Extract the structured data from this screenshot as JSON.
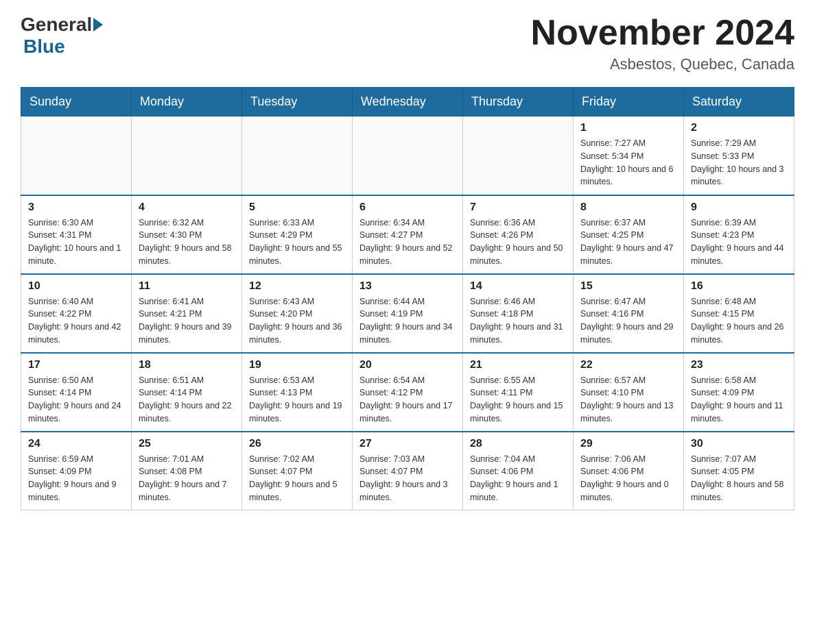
{
  "header": {
    "logo_general": "General",
    "logo_blue": "Blue",
    "month_title": "November 2024",
    "location": "Asbestos, Quebec, Canada"
  },
  "weekdays": [
    "Sunday",
    "Monday",
    "Tuesday",
    "Wednesday",
    "Thursday",
    "Friday",
    "Saturday"
  ],
  "weeks": [
    [
      {
        "day": "",
        "info": ""
      },
      {
        "day": "",
        "info": ""
      },
      {
        "day": "",
        "info": ""
      },
      {
        "day": "",
        "info": ""
      },
      {
        "day": "",
        "info": ""
      },
      {
        "day": "1",
        "info": "Sunrise: 7:27 AM\nSunset: 5:34 PM\nDaylight: 10 hours and 6 minutes."
      },
      {
        "day": "2",
        "info": "Sunrise: 7:29 AM\nSunset: 5:33 PM\nDaylight: 10 hours and 3 minutes."
      }
    ],
    [
      {
        "day": "3",
        "info": "Sunrise: 6:30 AM\nSunset: 4:31 PM\nDaylight: 10 hours and 1 minute."
      },
      {
        "day": "4",
        "info": "Sunrise: 6:32 AM\nSunset: 4:30 PM\nDaylight: 9 hours and 58 minutes."
      },
      {
        "day": "5",
        "info": "Sunrise: 6:33 AM\nSunset: 4:29 PM\nDaylight: 9 hours and 55 minutes."
      },
      {
        "day": "6",
        "info": "Sunrise: 6:34 AM\nSunset: 4:27 PM\nDaylight: 9 hours and 52 minutes."
      },
      {
        "day": "7",
        "info": "Sunrise: 6:36 AM\nSunset: 4:26 PM\nDaylight: 9 hours and 50 minutes."
      },
      {
        "day": "8",
        "info": "Sunrise: 6:37 AM\nSunset: 4:25 PM\nDaylight: 9 hours and 47 minutes."
      },
      {
        "day": "9",
        "info": "Sunrise: 6:39 AM\nSunset: 4:23 PM\nDaylight: 9 hours and 44 minutes."
      }
    ],
    [
      {
        "day": "10",
        "info": "Sunrise: 6:40 AM\nSunset: 4:22 PM\nDaylight: 9 hours and 42 minutes."
      },
      {
        "day": "11",
        "info": "Sunrise: 6:41 AM\nSunset: 4:21 PM\nDaylight: 9 hours and 39 minutes."
      },
      {
        "day": "12",
        "info": "Sunrise: 6:43 AM\nSunset: 4:20 PM\nDaylight: 9 hours and 36 minutes."
      },
      {
        "day": "13",
        "info": "Sunrise: 6:44 AM\nSunset: 4:19 PM\nDaylight: 9 hours and 34 minutes."
      },
      {
        "day": "14",
        "info": "Sunrise: 6:46 AM\nSunset: 4:18 PM\nDaylight: 9 hours and 31 minutes."
      },
      {
        "day": "15",
        "info": "Sunrise: 6:47 AM\nSunset: 4:16 PM\nDaylight: 9 hours and 29 minutes."
      },
      {
        "day": "16",
        "info": "Sunrise: 6:48 AM\nSunset: 4:15 PM\nDaylight: 9 hours and 26 minutes."
      }
    ],
    [
      {
        "day": "17",
        "info": "Sunrise: 6:50 AM\nSunset: 4:14 PM\nDaylight: 9 hours and 24 minutes."
      },
      {
        "day": "18",
        "info": "Sunrise: 6:51 AM\nSunset: 4:14 PM\nDaylight: 9 hours and 22 minutes."
      },
      {
        "day": "19",
        "info": "Sunrise: 6:53 AM\nSunset: 4:13 PM\nDaylight: 9 hours and 19 minutes."
      },
      {
        "day": "20",
        "info": "Sunrise: 6:54 AM\nSunset: 4:12 PM\nDaylight: 9 hours and 17 minutes."
      },
      {
        "day": "21",
        "info": "Sunrise: 6:55 AM\nSunset: 4:11 PM\nDaylight: 9 hours and 15 minutes."
      },
      {
        "day": "22",
        "info": "Sunrise: 6:57 AM\nSunset: 4:10 PM\nDaylight: 9 hours and 13 minutes."
      },
      {
        "day": "23",
        "info": "Sunrise: 6:58 AM\nSunset: 4:09 PM\nDaylight: 9 hours and 11 minutes."
      }
    ],
    [
      {
        "day": "24",
        "info": "Sunrise: 6:59 AM\nSunset: 4:09 PM\nDaylight: 9 hours and 9 minutes."
      },
      {
        "day": "25",
        "info": "Sunrise: 7:01 AM\nSunset: 4:08 PM\nDaylight: 9 hours and 7 minutes."
      },
      {
        "day": "26",
        "info": "Sunrise: 7:02 AM\nSunset: 4:07 PM\nDaylight: 9 hours and 5 minutes."
      },
      {
        "day": "27",
        "info": "Sunrise: 7:03 AM\nSunset: 4:07 PM\nDaylight: 9 hours and 3 minutes."
      },
      {
        "day": "28",
        "info": "Sunrise: 7:04 AM\nSunset: 4:06 PM\nDaylight: 9 hours and 1 minute."
      },
      {
        "day": "29",
        "info": "Sunrise: 7:06 AM\nSunset: 4:06 PM\nDaylight: 9 hours and 0 minutes."
      },
      {
        "day": "30",
        "info": "Sunrise: 7:07 AM\nSunset: 4:05 PM\nDaylight: 8 hours and 58 minutes."
      }
    ]
  ]
}
